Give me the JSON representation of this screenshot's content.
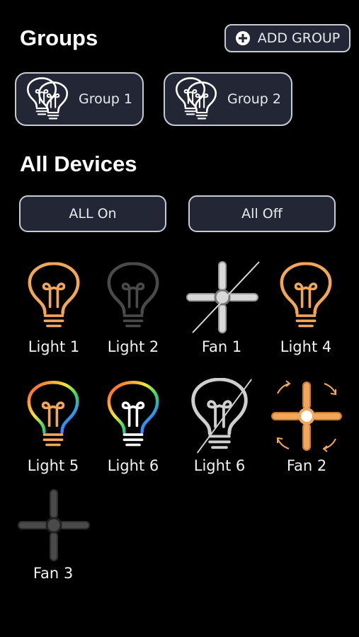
{
  "colors": {
    "background": "#000000",
    "button_bg": "#232634",
    "button_border": "#c9cbd3",
    "on": "#f2a65a",
    "off": "#4a4a4a",
    "unavailable": "#cfcfcf"
  },
  "groups": {
    "title": "Groups",
    "add_button_label": "ADD GROUP",
    "items": [
      {
        "label": "Group 1",
        "icon": "bulbs-group-icon"
      },
      {
        "label": "Group 2",
        "icon": "bulbs-group-icon"
      }
    ]
  },
  "devices": {
    "title": "All Devices",
    "all_on_label": "ALL On",
    "all_off_label": "All Off",
    "items": [
      {
        "label": "Light 1",
        "type": "light",
        "state": "on"
      },
      {
        "label": "Light 2",
        "type": "light",
        "state": "off"
      },
      {
        "label": "Fan 1",
        "type": "fan",
        "state": "unavailable"
      },
      {
        "label": "Light 4",
        "type": "light",
        "state": "on"
      },
      {
        "label": "Light 5",
        "type": "light",
        "state": "rgb"
      },
      {
        "label": "Light 6",
        "type": "light",
        "state": "rgb"
      },
      {
        "label": "Light 6",
        "type": "light",
        "state": "unavailable"
      },
      {
        "label": "Fan 2",
        "type": "fan",
        "state": "spinning"
      },
      {
        "label": "Fan 3",
        "type": "fan",
        "state": "off"
      }
    ]
  }
}
